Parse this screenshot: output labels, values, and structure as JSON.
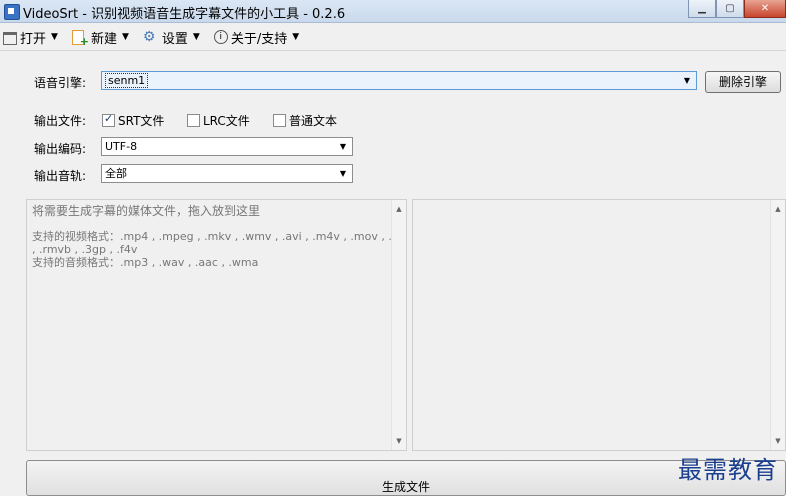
{
  "window": {
    "title": "VideoSrt - 识别视频语音生成字幕文件的小工具 - 0.2.6"
  },
  "menu": {
    "open": "打开",
    "new": "新建",
    "settings": "设置",
    "about": "关于/支持"
  },
  "engine": {
    "label": "语音引擎:",
    "value": "senm1",
    "delete_button": "删除引擎"
  },
  "output": {
    "label": "输出文件:",
    "options": [
      {
        "label": "SRT文件",
        "checked": true
      },
      {
        "label": "LRC文件",
        "checked": false
      },
      {
        "label": "普通文本",
        "checked": false
      }
    ]
  },
  "encoding": {
    "label": "输出编码:",
    "value": "UTF-8"
  },
  "audio_track": {
    "label": "输出音轨:",
    "value": "全部"
  },
  "drop_panel": {
    "line1": "将需要生成字幕的媒体文件，拖入放到这里",
    "line2": "支持的视频格式：.mp4 , .mpeg , .mkv , .wmv , .avi , .m4v , .mov , .flv",
    "line3": ", .rmvb , .3gp , .f4v",
    "line4": "支持的音频格式：.mp3 , .wav , .aac , .wma"
  },
  "generate_button": "生成文件",
  "watermark": "最需教育"
}
